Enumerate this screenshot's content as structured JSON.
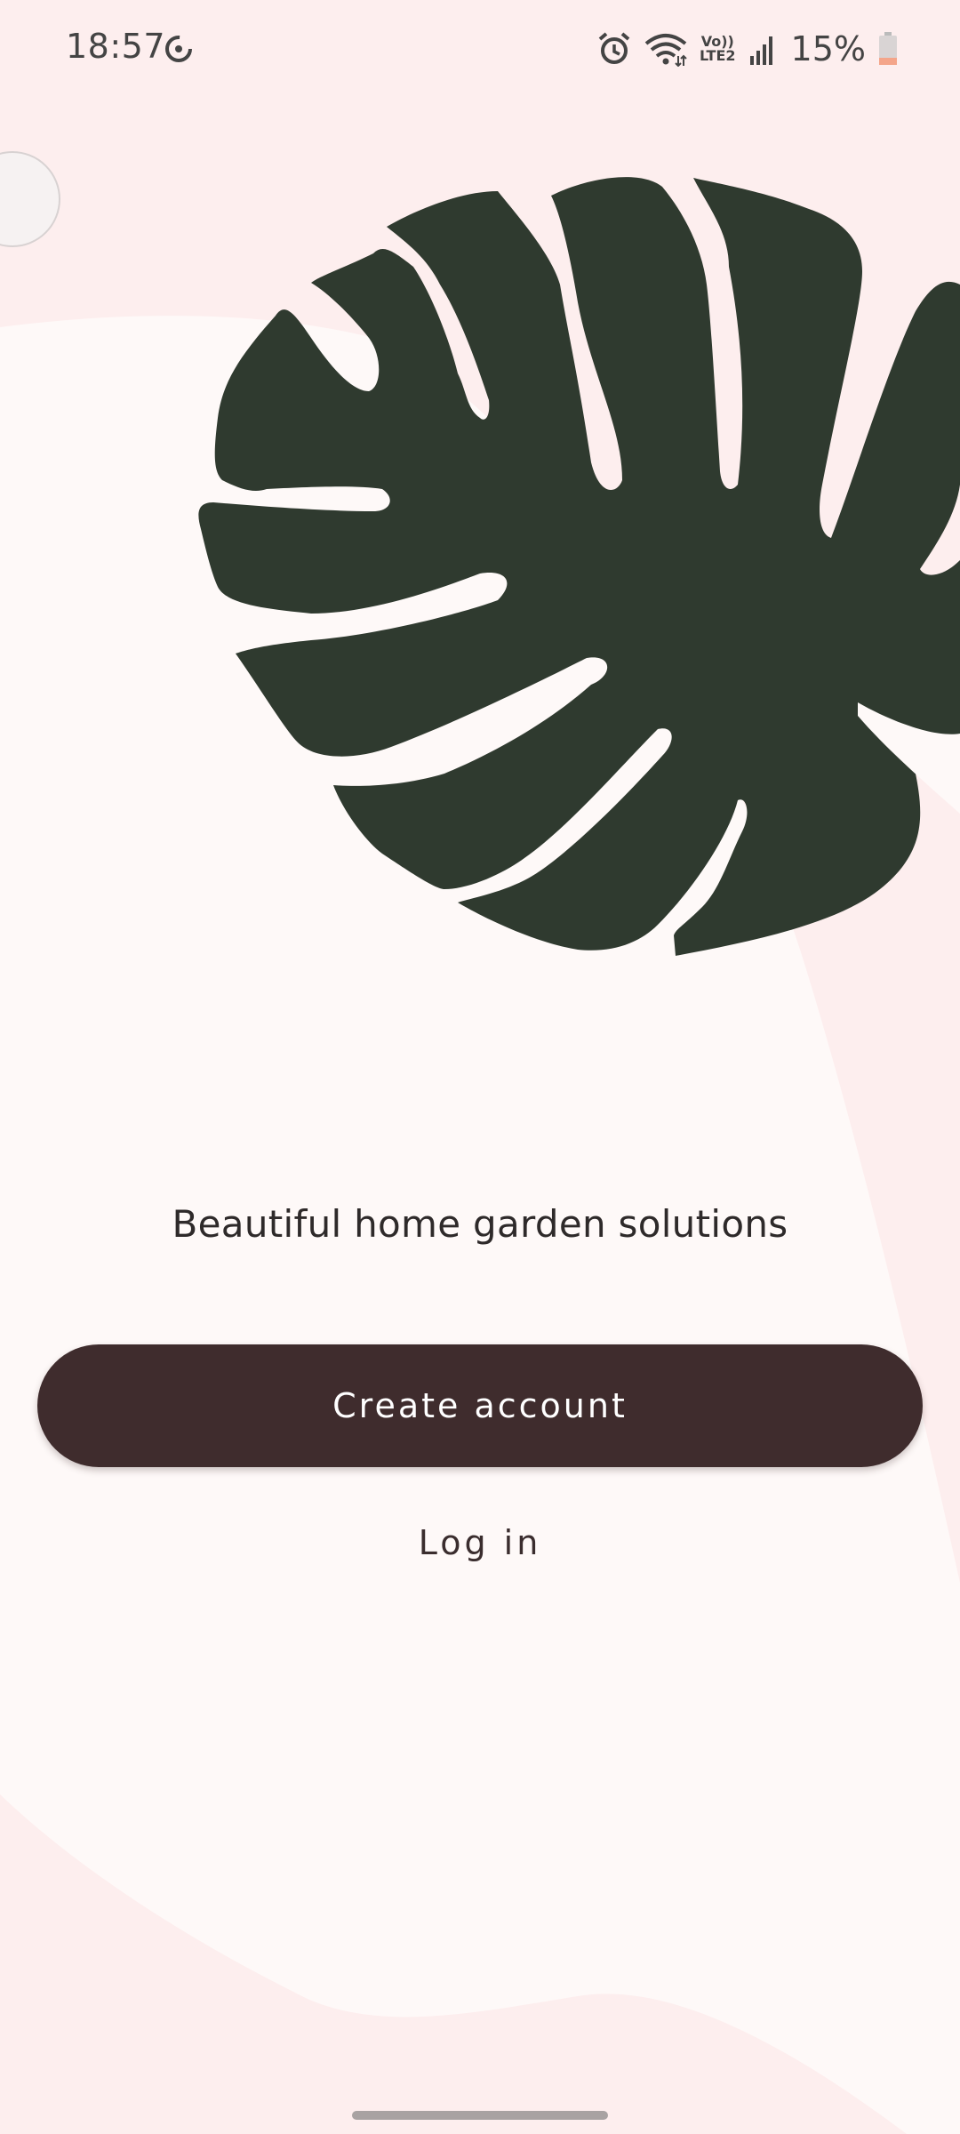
{
  "status_bar": {
    "time": "18:57",
    "sync_icon": "sync-icon",
    "alarm_icon": "alarm-icon",
    "wifi_icon": "wifi-icon",
    "volte_label": "Vo))",
    "lte_label": "LTE2",
    "signal_icon": "signal-icon",
    "battery_percent": "15%",
    "battery_icon": "battery-low-icon"
  },
  "welcome": {
    "illustration": "monstera-leaf-illustration",
    "tagline": "Beautiful home garden solutions"
  },
  "actions": {
    "create_account_label": "Create account",
    "login_label": "Log in"
  },
  "colors": {
    "background": "#fdeeee",
    "panel": "#fef9f8",
    "leaf": "#2f3a2f",
    "primary_button": "#3f2c2d",
    "primary_button_text": "#ffffff",
    "battery_low": "#f4a58a"
  }
}
